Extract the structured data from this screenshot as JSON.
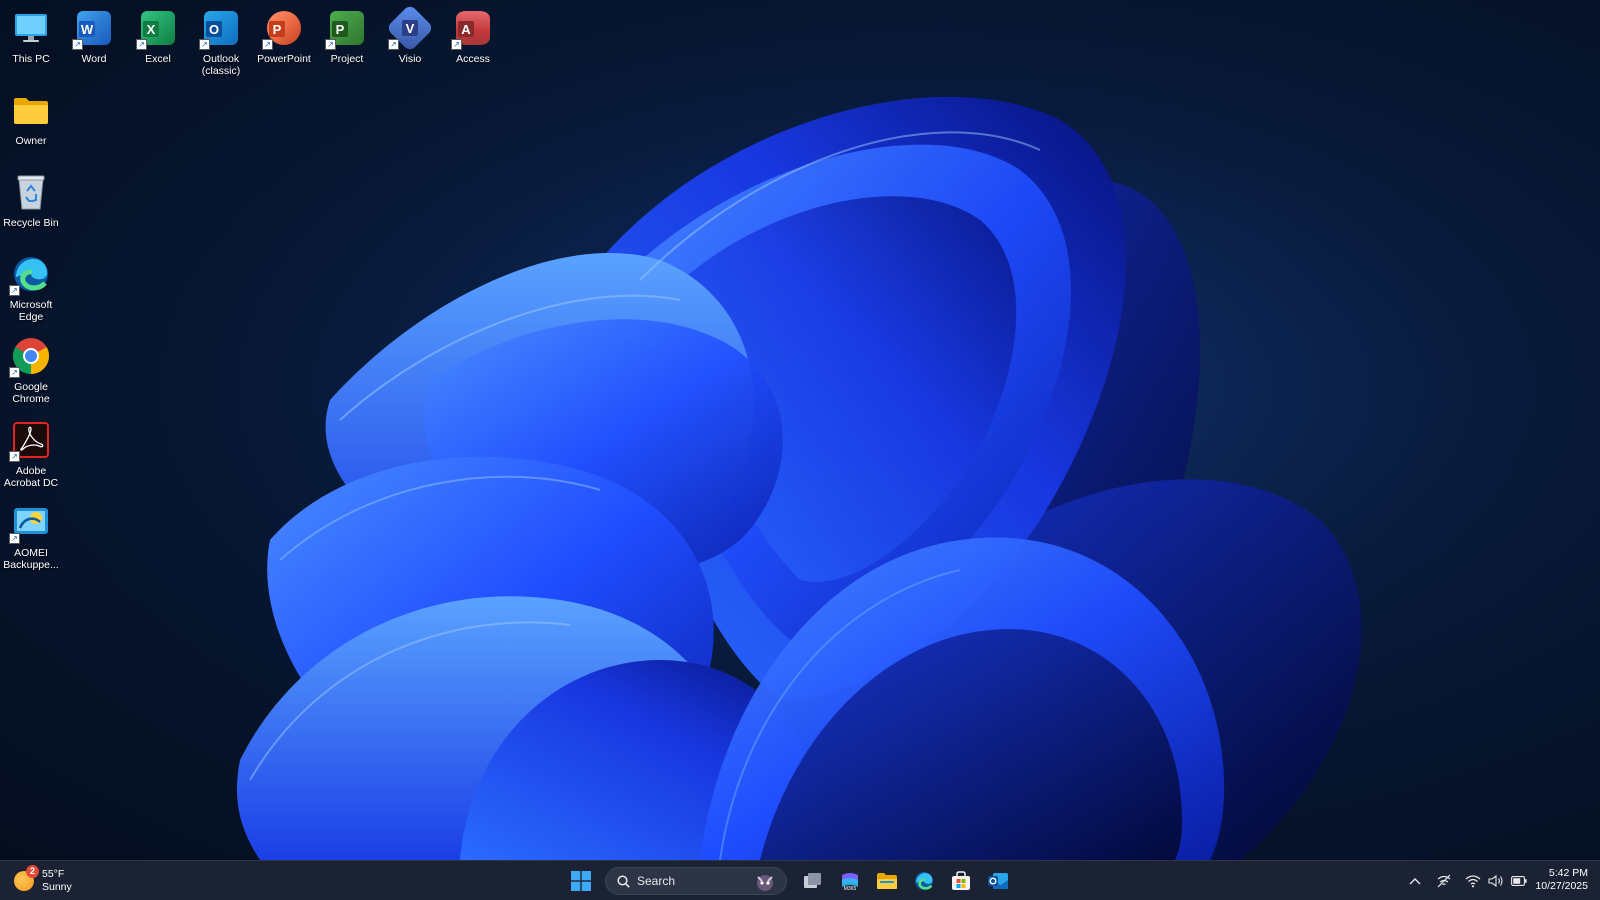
{
  "desktop": {
    "icons": [
      {
        "label": "This PC",
        "icon": "this-pc-icon"
      },
      {
        "label": "Word",
        "icon": "word-icon"
      },
      {
        "label": "Excel",
        "icon": "excel-icon"
      },
      {
        "label": "Outlook\n(classic)",
        "icon": "outlook-icon"
      },
      {
        "label": "PowerPoint",
        "icon": "powerpoint-icon"
      },
      {
        "label": "Project",
        "icon": "project-icon"
      },
      {
        "label": "Visio",
        "icon": "visio-icon"
      },
      {
        "label": "Access",
        "icon": "access-icon"
      },
      {
        "label": "Owner",
        "icon": "folder-icon"
      },
      {
        "label": "Recycle Bin",
        "icon": "recycle-bin-icon"
      },
      {
        "label": "Microsoft\nEdge",
        "icon": "edge-icon"
      },
      {
        "label": "Google\nChrome",
        "icon": "chrome-icon"
      },
      {
        "label": "Adobe\nAcrobat DC",
        "icon": "acrobat-icon"
      },
      {
        "label": "AOMEI\nBackuppe...",
        "icon": "aomei-backupper-icon"
      }
    ]
  },
  "taskbar": {
    "weather": {
      "badge": "2",
      "temperature": "55°F",
      "condition": "Sunny"
    },
    "search_placeholder": "Search",
    "pinned": [
      {
        "name": "start-button",
        "icon": "windows-logo-icon"
      },
      {
        "name": "task-view-button",
        "icon": "task-view-icon"
      },
      {
        "name": "microsoft-365-copilot-button",
        "icon": "microsoft-365-icon"
      },
      {
        "name": "file-explorer-button",
        "icon": "folder-icon"
      },
      {
        "name": "edge-button",
        "icon": "edge-icon"
      },
      {
        "name": "microsoft-store-button",
        "icon": "store-icon"
      },
      {
        "name": "outlook-button",
        "icon": "outlook-icon"
      }
    ],
    "tray_icons": [
      "chevron-up-icon",
      "network-off-icon",
      "wifi-icon",
      "volume-icon",
      "battery-icon"
    ],
    "clock": {
      "time": "5:42 PM",
      "date": "10/27/2025"
    }
  },
  "colors": {
    "wallpaper_dark": "#061228",
    "wallpaper_bloom": "#1a4bff",
    "taskbar_bg": "#1b2233",
    "word": "#185abd",
    "excel": "#107c41",
    "outlook": "#0f6cbd",
    "powerpoint": "#c43e1c",
    "project": "#31752f",
    "visio": "#3955a3",
    "access": "#a4373a"
  }
}
